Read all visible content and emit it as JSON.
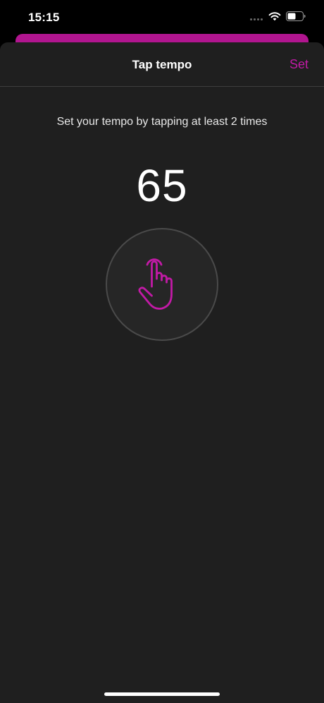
{
  "status_bar": {
    "time": "15:15",
    "signal_icon": "signal-dots-icon",
    "wifi_icon": "wifi-icon",
    "battery_icon": "battery-icon"
  },
  "sheet": {
    "title": "Tap tempo",
    "set_label": "Set",
    "instruction": "Set your tempo by tapping at least 2 times",
    "tempo": "65",
    "tap_icon": "tap-hand-icon"
  },
  "colors": {
    "accent": "#c21aa6",
    "underlay": "#b1158f",
    "sheet_background": "#1f1f1f",
    "screen_background": "#000000",
    "tap_button_fill": "#262626",
    "tap_button_border": "#4a4a4a"
  }
}
